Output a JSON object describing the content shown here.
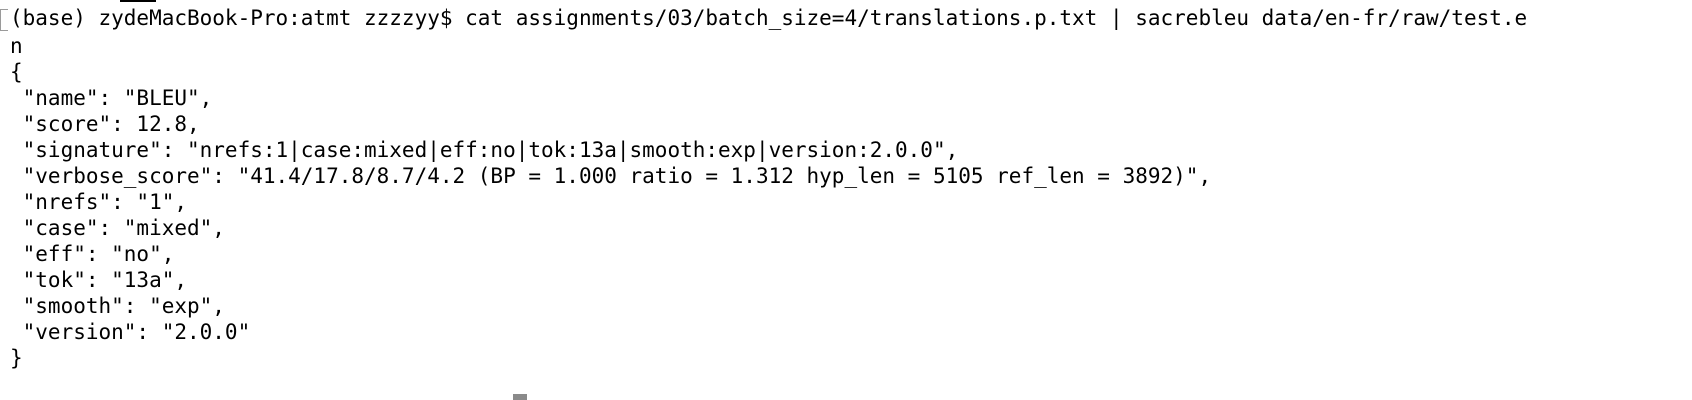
{
  "terminal": {
    "command_line": "(base) zydeMacBook-Pro:atmt zzzzyy$ cat assignments/03/batch_size=4/translations.p.txt | sacrebleu data/en-fr/raw/test.e",
    "wrapped_continuation": "n",
    "output_lines": [
      "{",
      " \"name\": \"BLEU\",",
      " \"score\": 12.8,",
      " \"signature\": \"nrefs:1|case:mixed|eff:no|tok:13a|smooth:exp|version:2.0.0\",",
      " \"verbose_score\": \"41.4/17.8/8.7/4.2 (BP = 1.000 ratio = 1.312 hyp_len = 5105 ref_len = 3892)\",",
      " \"nrefs\": \"1\",",
      " \"case\": \"mixed\",",
      " \"eff\": \"no\",",
      " \"tok\": \"13a\",",
      " \"smooth\": \"exp\",",
      " \"version\": \"2.0.0\"",
      "}"
    ]
  }
}
